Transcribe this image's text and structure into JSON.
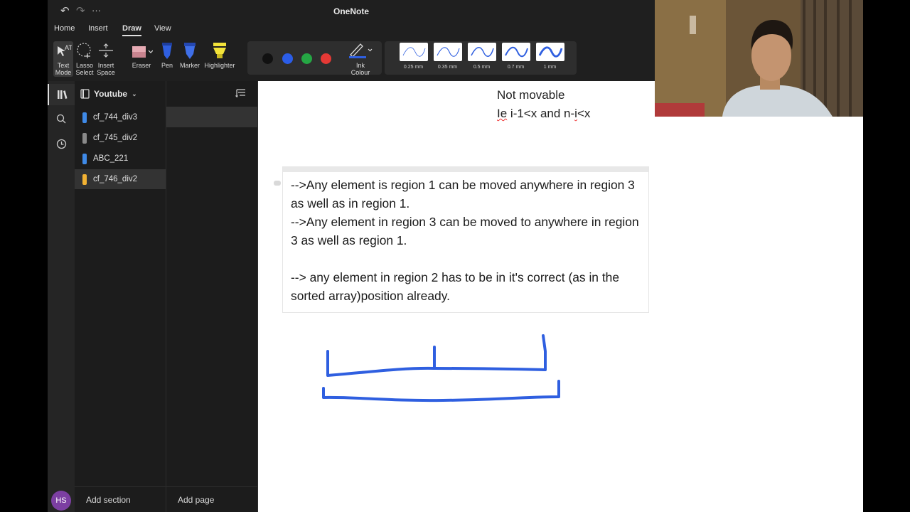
{
  "app": {
    "title": "OneNote"
  },
  "titlebar": {
    "more": "···"
  },
  "tabs": [
    "Home",
    "Insert",
    "Draw",
    "View"
  ],
  "active_tab": "Draw",
  "tools": {
    "text_mode": [
      "Text",
      "Mode"
    ],
    "lasso_select": [
      "Lasso",
      "Select"
    ],
    "insert_space": [
      "Insert",
      "Space"
    ],
    "eraser": "Eraser",
    "pen": "Pen",
    "marker": "Marker",
    "highlighter": "Highlighter",
    "ink_colour": [
      "Ink",
      "Colour"
    ]
  },
  "colors": {
    "black": "#111111",
    "blue": "#2b5de8",
    "green": "#25a744",
    "red": "#e53935",
    "ink": "#2f5fe0"
  },
  "thickness": [
    "0.25 mm",
    "0.35 mm",
    "0.5 mm",
    "0.7 mm",
    "1 mm"
  ],
  "notebook": {
    "name": "Youtube"
  },
  "sections": [
    {
      "label": "cf_744_div3",
      "color": "#3f8ae8"
    },
    {
      "label": "cf_745_div2",
      "color": "#8a8a8a"
    },
    {
      "label": "ABC_221",
      "color": "#3f8ae8"
    },
    {
      "label": "cf_746_div2",
      "color": "#f2b233"
    }
  ],
  "bottom": {
    "avatar": "HS",
    "add_section": "Add section",
    "add_page": "Add page"
  },
  "canvas": {
    "prev_line1": "Not movable",
    "prev_line2_a": "Ie",
    "prev_line2_b": " i-1<x and n-",
    "prev_line2_c": "i",
    "prev_line2_d": "<x",
    "note_text": "-->Any element is region 1 can be moved anywhere in region 3 as well as in region 1.\n-->Any element in region 3 can be moved to anywhere in region 3 as well as region 1.\n\n--> any element in region 2 has to be in it's correct (as in the sorted array)position already."
  }
}
